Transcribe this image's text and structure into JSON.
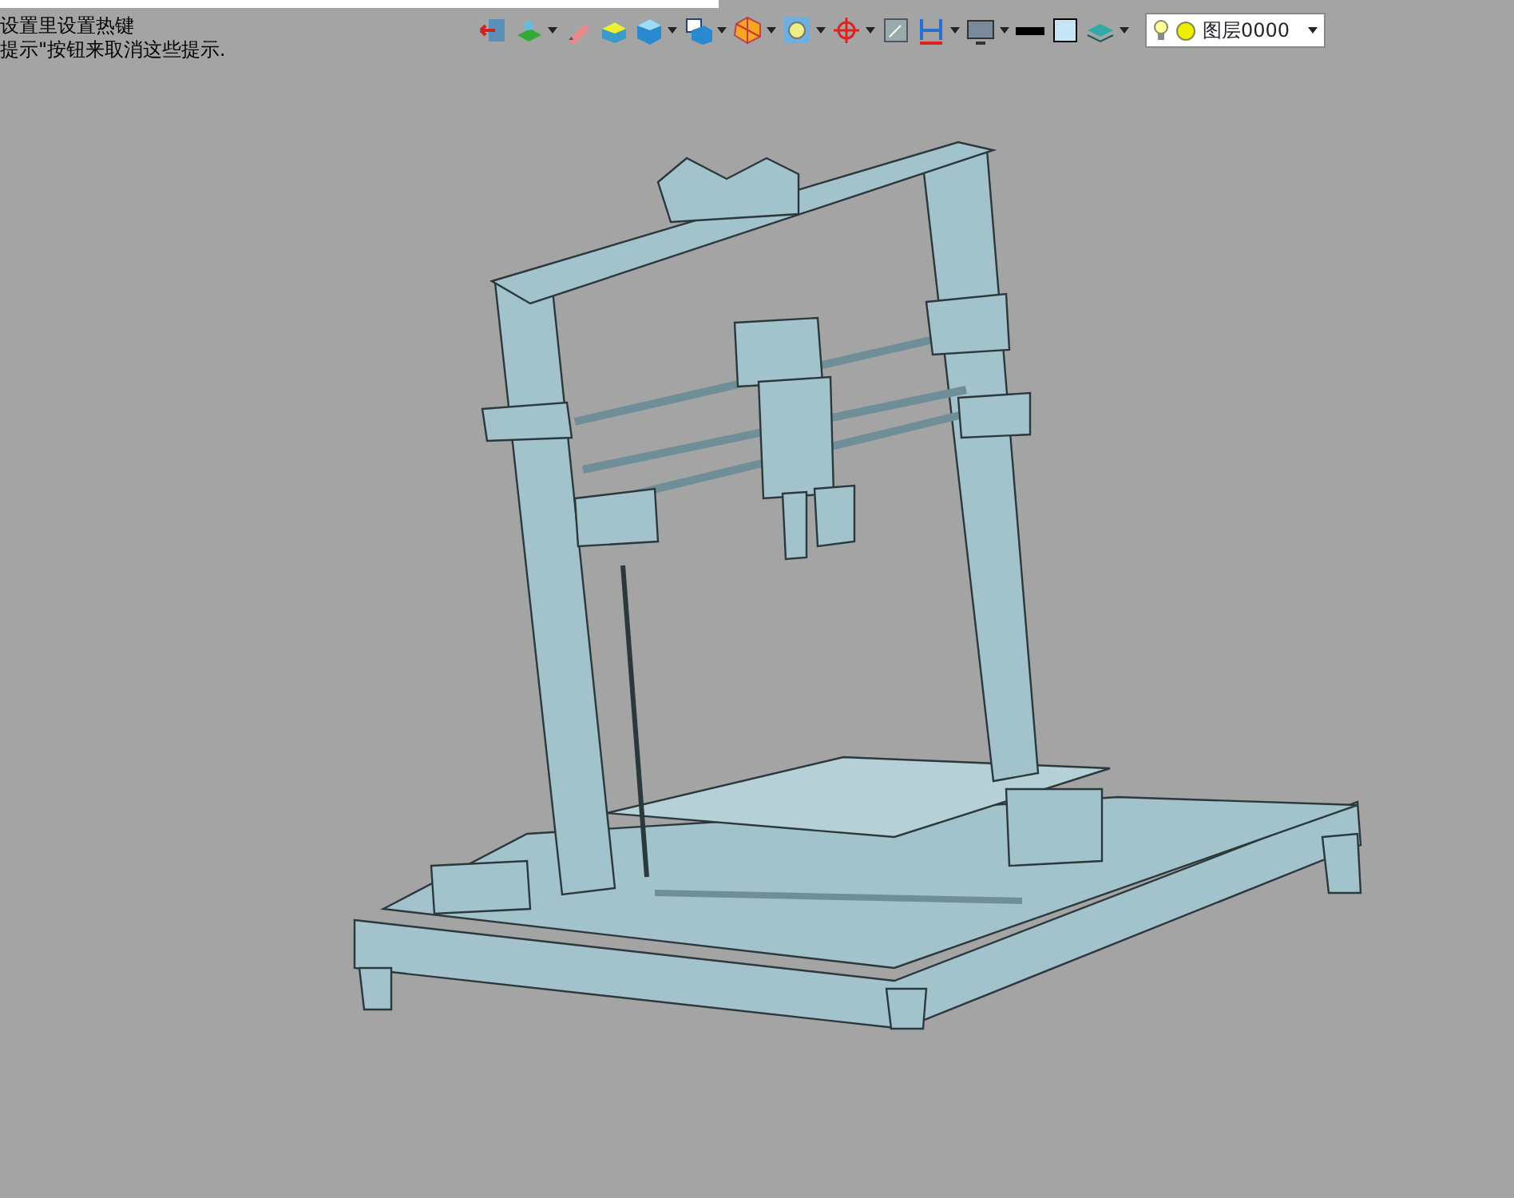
{
  "hint": {
    "lines": [
      "设置里设置热键",
      "提示\"按钮来取消这些提示."
    ]
  },
  "toolbar": {
    "tools": [
      {
        "kind": "exit",
        "dropdown": false
      },
      {
        "kind": "layer",
        "dropdown": true
      },
      {
        "kind": "pencil",
        "dropdown": false
      },
      {
        "kind": "face",
        "dropdown": false
      },
      {
        "kind": "cube",
        "dropdown": true
      },
      {
        "kind": "view",
        "dropdown": true
      },
      {
        "kind": "polygon",
        "dropdown": true
      },
      {
        "kind": "zoom",
        "dropdown": true
      },
      {
        "kind": "crosshair",
        "dropdown": true
      },
      {
        "kind": "window",
        "dropdown": false
      },
      {
        "kind": "dimension",
        "dropdown": true
      },
      {
        "kind": "monitor",
        "dropdown": true
      },
      {
        "kind": "linestyle",
        "dropdown": false
      },
      {
        "kind": "color",
        "dropdown": false
      },
      {
        "kind": "stack",
        "dropdown": true
      }
    ]
  },
  "layer_combo": {
    "text": "图层0000"
  }
}
